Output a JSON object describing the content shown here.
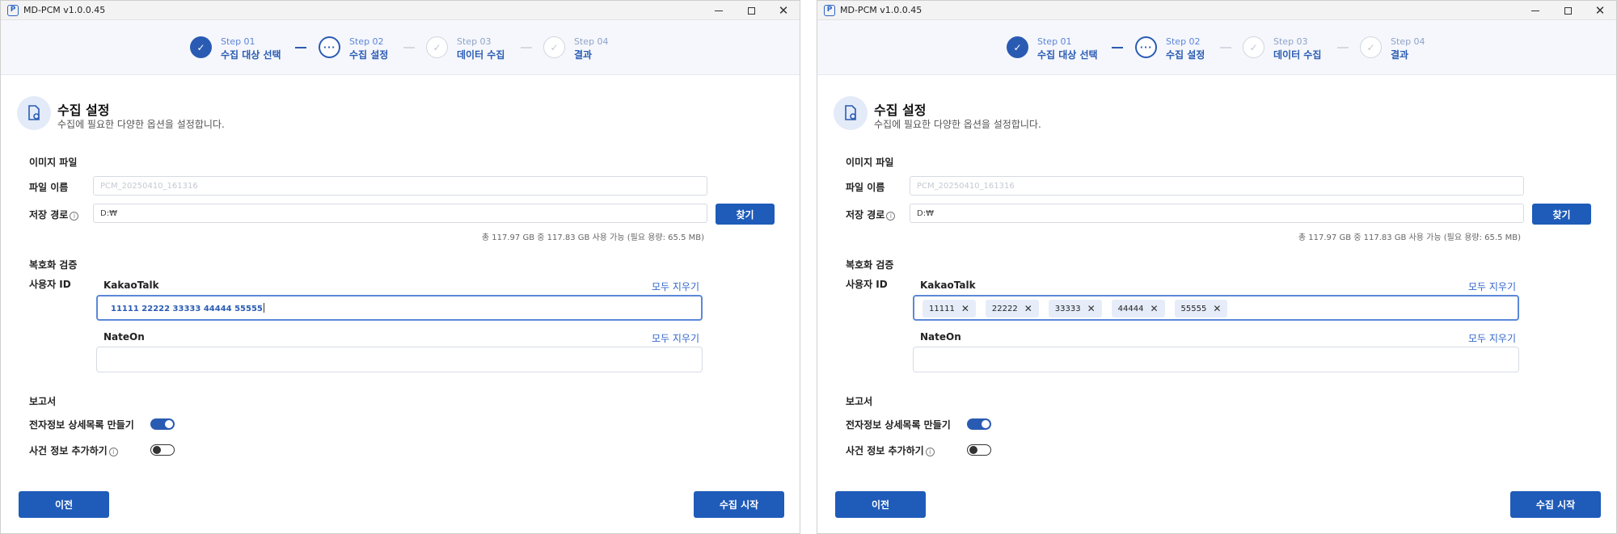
{
  "windows": [
    {
      "app_title": "MD-PCM v1.0.0.45",
      "steps": [
        {
          "num": "Step 01",
          "name": "수집 대상 선택",
          "state": "done"
        },
        {
          "num": "Step 02",
          "name": "수집 설정",
          "state": "current"
        },
        {
          "num": "Step 03",
          "name": "데이터 수집",
          "state": "todo"
        },
        {
          "num": "Step 04",
          "name": "결과",
          "state": "todo"
        }
      ],
      "header": {
        "title": "수집 설정",
        "description": "수집에 필요한 다양한 옵션을 설정합니다."
      },
      "image_file": {
        "section_title": "이미지 파일",
        "file_name_label": "파일 이름",
        "file_name_placeholder": "PCM_20250410_161316",
        "save_path_label": "저장 경로",
        "save_path_value": "D:₩",
        "browse_label": "찾기",
        "disk_usage": "총 117.97 GB 중 117.83 GB 사용 가능 (필요 용량: 65.5 MB)"
      },
      "decrypt": {
        "section_title": "복호화 검증",
        "user_id_label": "사용자 ID",
        "kakaotalk_label": "KakaoTalk",
        "kakaotalk_clear": "모두 지우기",
        "kakaotalk_input": "11111 22222 33333 44444 55555",
        "nateon_label": "NateOn",
        "nateon_clear": "모두 지우기"
      },
      "report": {
        "section_title": "보고서",
        "detail_list_label": "전자정보 상세목록 만들기",
        "detail_list_on": true,
        "case_info_label": "사건 정보 추가하기",
        "case_info_on": false
      },
      "footer": {
        "prev_label": "이전",
        "start_label": "수집 시작"
      }
    },
    {
      "app_title": "MD-PCM v1.0.0.45",
      "steps": [
        {
          "num": "Step 01",
          "name": "수집 대상 선택",
          "state": "done"
        },
        {
          "num": "Step 02",
          "name": "수집 설정",
          "state": "current"
        },
        {
          "num": "Step 03",
          "name": "데이터 수집",
          "state": "todo"
        },
        {
          "num": "Step 04",
          "name": "결과",
          "state": "todo"
        }
      ],
      "header": {
        "title": "수집 설정",
        "description": "수집에 필요한 다양한 옵션을 설정합니다."
      },
      "image_file": {
        "section_title": "이미지 파일",
        "file_name_label": "파일 이름",
        "file_name_placeholder": "PCM_20250410_161316",
        "save_path_label": "저장 경로",
        "save_path_value": "D:₩",
        "browse_label": "찾기",
        "disk_usage": "총 117.97 GB 중 117.83 GB 사용 가능 (필요 용량: 65.5 MB)"
      },
      "decrypt": {
        "section_title": "복호화 검증",
        "user_id_label": "사용자 ID",
        "kakaotalk_label": "KakaoTalk",
        "kakaotalk_clear": "모두 지우기",
        "kakaotalk_chips": [
          "11111",
          "22222",
          "33333",
          "44444",
          "55555"
        ],
        "nateon_label": "NateOn",
        "nateon_clear": "모두 지우기"
      },
      "report": {
        "section_title": "보고서",
        "detail_list_label": "전자정보 상세목록 만들기",
        "detail_list_on": true,
        "case_info_label": "사건 정보 추가하기",
        "case_info_on": false
      },
      "footer": {
        "prev_label": "이전",
        "start_label": "수집 시작"
      }
    }
  ],
  "icons": {
    "app": "app-logo-icon",
    "minimize": "minimize-icon",
    "maximize": "maximize-icon",
    "close": "close-icon",
    "step_done": "check-icon",
    "step_current": "ellipsis-icon",
    "header": "settings-document-icon",
    "info": "info-icon",
    "chip_remove": "remove-icon"
  },
  "colors": {
    "accent": "#1f5bb8",
    "stepper_bg": "#f5f7fc",
    "chip_bg": "#e6edf9"
  }
}
